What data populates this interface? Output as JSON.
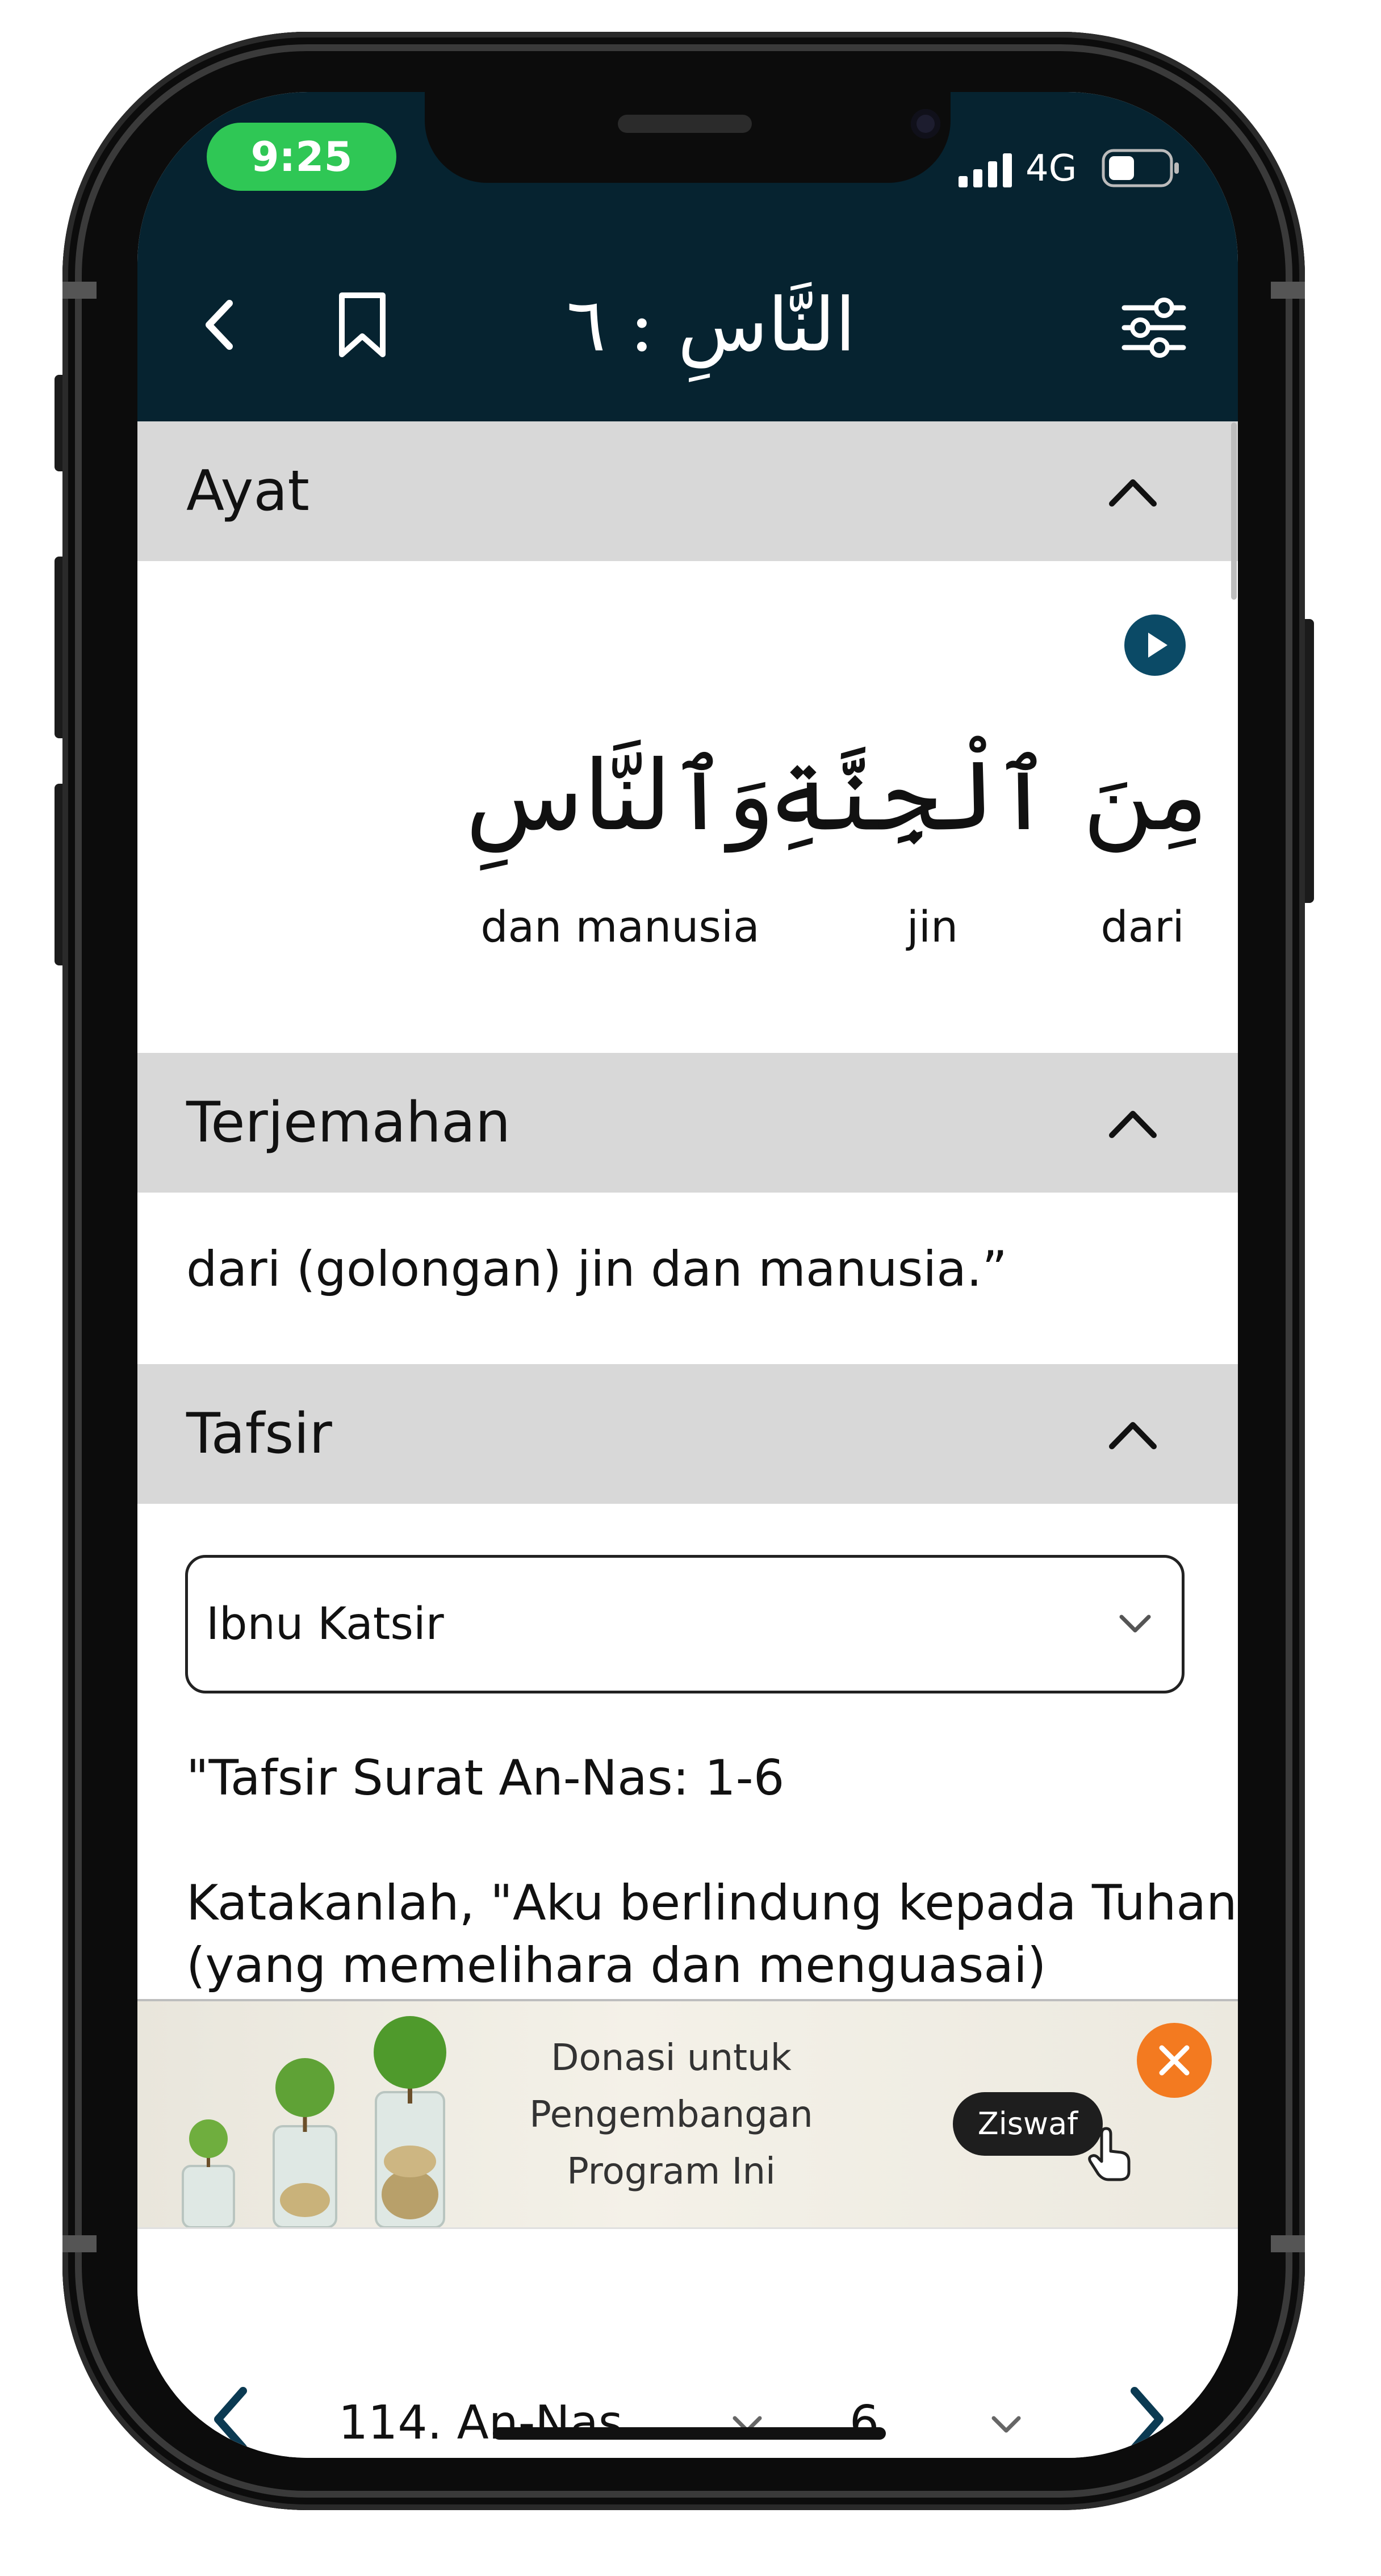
{
  "status_bar": {
    "time": "9:25",
    "network": "4G"
  },
  "header": {
    "title_arabic": "النَّاسِ : ٦"
  },
  "sections": {
    "ayat": {
      "title": "Ayat",
      "words": [
        {
          "arabic": "مِنَ",
          "translation": "dari"
        },
        {
          "arabic": "ٱلْجِنَّةِ",
          "translation": "jin"
        },
        {
          "arabic": "وَٱلنَّاسِ",
          "translation": "dan manusia"
        }
      ]
    },
    "terjemahan": {
      "title": "Terjemahan",
      "text": "dari (golongan) jin dan manusia.”"
    },
    "tafsir": {
      "title": "Tafsir",
      "selected_source": "Ibnu Katsir",
      "heading": "\"Tafsir Surat An-Nas: 1-6",
      "text_line1": "Katakanlah, \"Aku berlindung kepada Tuhan",
      "text_line2": "(yang memelihara dan menguasai)"
    }
  },
  "ad_banner": {
    "line1": "Donasi untuk",
    "line2": "Pengembangan",
    "line3": "Program Ini",
    "button_label": "Ziswaf"
  },
  "bottom_nav": {
    "surah_selected": "114. An-Nas",
    "ayah_selected": "6"
  },
  "colors": {
    "header_bg": "#062330",
    "accent": "#0b4a66",
    "section_header_bg": "#d8d8d8",
    "time_pill": "#2fc755",
    "close_button": "#f37a20"
  }
}
